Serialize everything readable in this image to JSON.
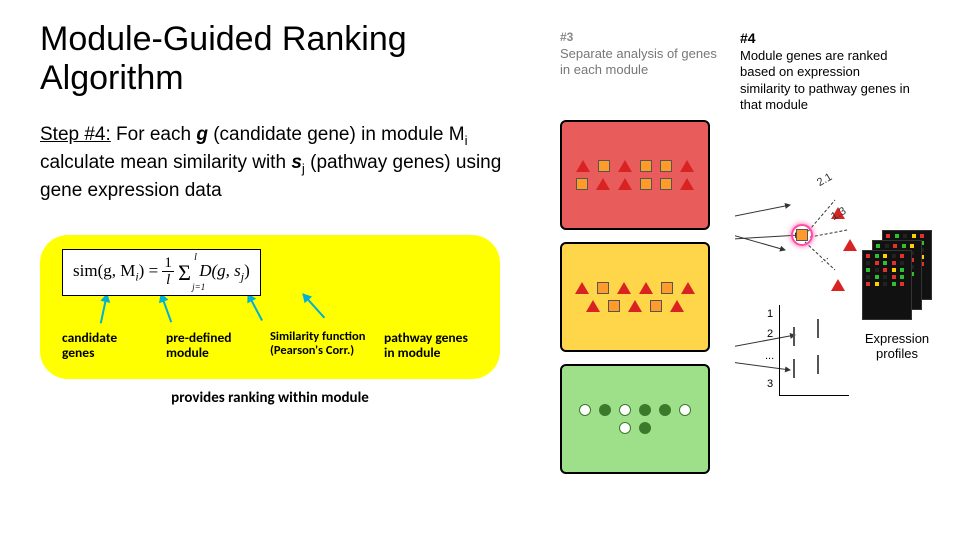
{
  "title": "Module-Guided Ranking Algorithm",
  "step": {
    "label": "Step #4:",
    "text_parts": {
      "a": " For each ",
      "g": "g",
      "b": " (candidate gene) in module M",
      "i": "i",
      "c": " calculate mean similarity with ",
      "sj": "s",
      "j": "j",
      "d": " (pathway genes) using gene expression data"
    }
  },
  "formula": {
    "sim": "sim",
    "args": "(g, M",
    "i": "i",
    "close": ") =",
    "num": "1",
    "den": "l",
    "sigma_sup": "l",
    "sigma_sub": "j=1",
    "D": "D(g, s",
    "j": "j",
    "end": ")"
  },
  "formula_labels": {
    "cand": "candidate genes",
    "mod": "pre-defined module",
    "sim": "Similarity function (Pearson's Corr.)",
    "path": "pathway genes in module"
  },
  "caption": "provides ranking within module",
  "right": {
    "col3": {
      "num": "#3",
      "sub": "Separate analysis of genes in each module"
    },
    "col4": {
      "num": "#4",
      "sub": "Module genes are ranked based on expression similarity to pathway genes in that module"
    },
    "scores": {
      "a": "2.1",
      "b": "1.3",
      "c": "..."
    },
    "axis_ticks": [
      "1",
      "2",
      "...",
      "3"
    ],
    "expr_label": "Expression profiles"
  }
}
